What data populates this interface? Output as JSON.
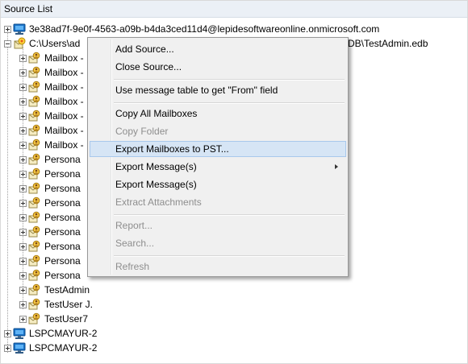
{
  "panel": {
    "title": "Source List"
  },
  "tree": {
    "nodes": [
      {
        "label": "3e38ad7f-9e0f-4563-a09b-b4da3ced11d4@lepidesoftwareonline.onmicrosoft.com",
        "icon": "computer-icon",
        "expander": "plus"
      },
      {
        "label": "C:\\Users\\ad",
        "icon": "database-icon",
        "expander": "minus"
      },
      {
        "label": "Mailbox -",
        "icon": "mailbox-icon"
      },
      {
        "label": "Mailbox -",
        "icon": "mailbox-icon"
      },
      {
        "label": "Mailbox -",
        "icon": "mailbox-icon"
      },
      {
        "label": "Mailbox -",
        "icon": "mailbox-icon"
      },
      {
        "label": "Mailbox -",
        "icon": "mailbox-icon"
      },
      {
        "label": "Mailbox -",
        "icon": "mailbox-icon"
      },
      {
        "label": "Mailbox -",
        "icon": "mailbox-icon"
      },
      {
        "label": "Persona",
        "icon": "mailbox-icon"
      },
      {
        "label": "Persona",
        "icon": "mailbox-icon"
      },
      {
        "label": "Persona",
        "icon": "mailbox-icon"
      },
      {
        "label": "Persona",
        "icon": "mailbox-icon"
      },
      {
        "label": "Persona",
        "icon": "mailbox-icon"
      },
      {
        "label": "Persona",
        "icon": "mailbox-icon"
      },
      {
        "label": "Persona",
        "icon": "mailbox-icon"
      },
      {
        "label": "Persona",
        "icon": "mailbox-icon"
      },
      {
        "label": "Persona",
        "icon": "mailbox-icon"
      },
      {
        "label": "TestAdmin",
        "icon": "mailbox-icon"
      },
      {
        "label": "TestUser J.",
        "icon": "mailbox-icon"
      },
      {
        "label": "TestUser7",
        "icon": "mailbox-icon"
      },
      {
        "label": "LSPCMAYUR-2",
        "icon": "computer-icon",
        "expander": "plus"
      },
      {
        "label": "LSPCMAYUR-2",
        "icon": "computer-icon",
        "expander": "plus"
      }
    ],
    "path_tail": "DB\\TestAdmin.edb"
  },
  "context_menu": {
    "items": [
      {
        "label": "Add Source...",
        "enabled": true
      },
      {
        "label": "Close Source...",
        "enabled": true
      },
      {
        "separator": true
      },
      {
        "label": "Use message table to get \"From\" field",
        "enabled": true
      },
      {
        "separator": true
      },
      {
        "label": "Copy All Mailboxes",
        "enabled": true
      },
      {
        "label": "Copy Folder",
        "enabled": false
      },
      {
        "label": "Export Mailboxes to PST...",
        "enabled": true,
        "highlighted": true
      },
      {
        "label": "Export Message(s)",
        "enabled": true,
        "submenu": true
      },
      {
        "label": "Export Message(s)",
        "enabled": true
      },
      {
        "label": "Extract Attachments",
        "enabled": false
      },
      {
        "separator": true
      },
      {
        "label": "Report...",
        "enabled": false
      },
      {
        "label": "Search...",
        "enabled": false
      },
      {
        "separator": true
      },
      {
        "label": "Refresh",
        "enabled": false
      }
    ]
  },
  "colors": {
    "header_bg": "#ebf0f6",
    "menu_bg": "#f0f0f0",
    "highlight_bg": "#d6e5f5",
    "highlight_border": "#a8c8ec",
    "disabled_text": "#8e8e8e"
  }
}
